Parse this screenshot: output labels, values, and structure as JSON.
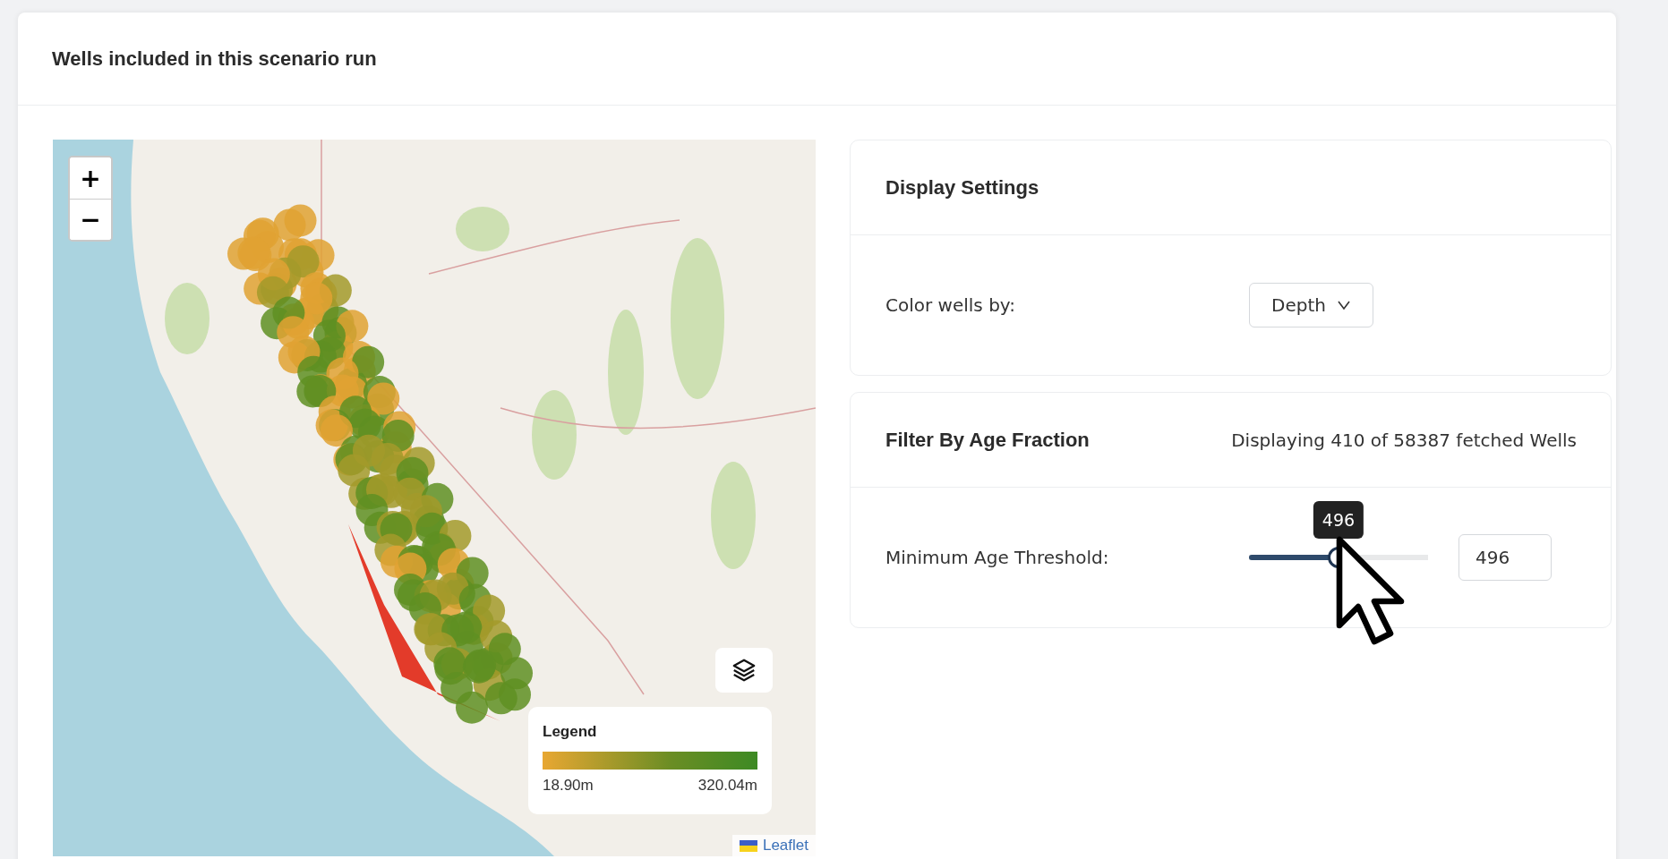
{
  "card": {
    "title": "Wells included in this scenario run"
  },
  "map": {
    "zoom_in": "+",
    "zoom_out": "−",
    "legend": {
      "title": "Legend",
      "min": "18.90m",
      "max": "320.04m"
    },
    "attribution": "Leaflet"
  },
  "display_settings": {
    "title": "Display Settings",
    "label": "Color wells by:",
    "select": {
      "value": "Depth"
    }
  },
  "filter": {
    "title": "Filter By Age Fraction",
    "summary": "Displaying 410 of 58387 fetched Wells",
    "label": "Minimum Age Threshold:",
    "slider": {
      "level": 0.5,
      "tooltip": "496"
    },
    "input": {
      "value": "496"
    }
  }
}
